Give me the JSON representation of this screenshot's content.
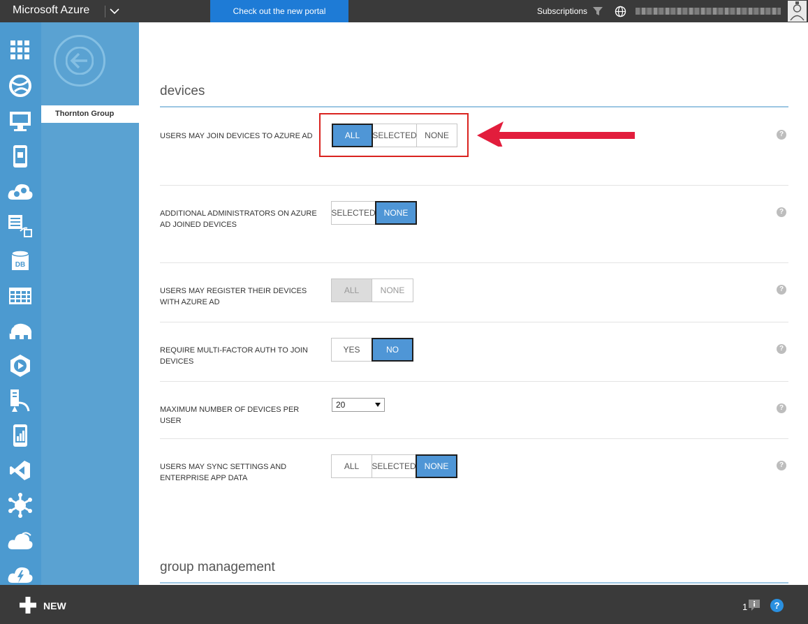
{
  "topbar": {
    "brand": "Microsoft Azure",
    "portal_link": "Check out the new portal",
    "subscriptions": "Subscriptions",
    "icons": [
      "chevron-down-icon",
      "filter-icon",
      "globe-icon",
      "avatar"
    ]
  },
  "leftnav": {
    "icons": [
      "all-items-icon",
      "web-apps-icon",
      "virtual-machines-icon",
      "mobile-services-icon",
      "cloud-services-icon",
      "batch-services-icon",
      "sql-databases-icon",
      "storage-icon",
      "hdinsight-icon",
      "media-services-icon",
      "service-bus-icon",
      "mobile-engagement-icon",
      "visual-studio-online-icon",
      "cache-icon",
      "biztalk-services-icon",
      "scheduler-icon"
    ]
  },
  "subnav": {
    "item": "Thornton Group"
  },
  "main": {
    "devices_title": "devices",
    "group_title": "group management",
    "rows": [
      {
        "label": "USERS MAY JOIN DEVICES TO AZURE AD",
        "options": [
          "ALL",
          "SELECTED",
          "NONE"
        ],
        "selected": "ALL"
      },
      {
        "label": "ADDITIONAL ADMINISTRATORS ON AZURE AD JOINED DEVICES",
        "options": [
          "SELECTED",
          "NONE"
        ],
        "selected": "NONE"
      },
      {
        "label": "USERS MAY REGISTER THEIR DEVICES WITH AZURE AD",
        "options": [
          "ALL",
          "NONE"
        ],
        "selected": "ALL",
        "disabled": true
      },
      {
        "label": "REQUIRE MULTI-FACTOR AUTH TO JOIN DEVICES",
        "options": [
          "YES",
          "NO"
        ],
        "selected": "NO"
      },
      {
        "label": "MAXIMUM NUMBER OF DEVICES PER USER",
        "select_value": "20"
      },
      {
        "label": "USERS MAY SYNC SETTINGS AND ENTERPRISE APP DATA",
        "options": [
          "ALL",
          "SELECTED",
          "NONE"
        ],
        "selected": "NONE"
      }
    ],
    "help_glyph": "?"
  },
  "bottombar": {
    "new_label": "NEW",
    "notification_count": "1",
    "help_glyph": "?"
  },
  "colors": {
    "topbar": "#3a3a3a",
    "accent": "#4f96d6",
    "portal_button": "#1e7bd6",
    "nav": "#4c9ad0",
    "callout": "#d9231f"
  }
}
